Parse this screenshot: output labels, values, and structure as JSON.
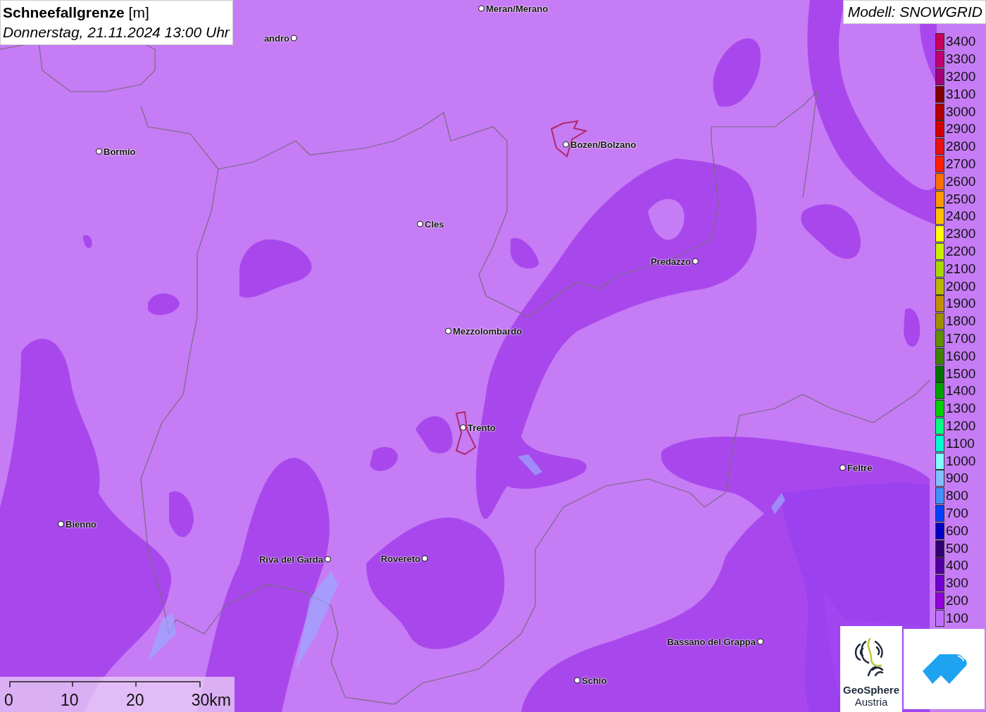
{
  "title": {
    "name": "Schneefallgrenze",
    "unit": "[m]",
    "datetime": "Donnerstag, 21.11.2024 13:00 Uhr"
  },
  "model": "Modell: SNOWGRID",
  "cities": [
    {
      "name": "Meran/Merano"
    },
    {
      "name": "andro"
    },
    {
      "name": "Bormio"
    },
    {
      "name": "Bozen/Bolzano"
    },
    {
      "name": "Cles"
    },
    {
      "name": "Predazzo"
    },
    {
      "name": "Mezzolombardo"
    },
    {
      "name": "Trento"
    },
    {
      "name": "Feltre"
    },
    {
      "name": "Bienno"
    },
    {
      "name": "Riva del Garda"
    },
    {
      "name": "Rovereto"
    },
    {
      "name": "Bassano del Grappa"
    },
    {
      "name": "Schio"
    }
  ],
  "legend": [
    {
      "label": "3400",
      "color": "#c8005a"
    },
    {
      "label": "3300",
      "color": "#c0006e"
    },
    {
      "label": "3200",
      "color": "#a00078"
    },
    {
      "label": "3100",
      "color": "#800000"
    },
    {
      "label": "3000",
      "color": "#b00000"
    },
    {
      "label": "2900",
      "color": "#d00000"
    },
    {
      "label": "2800",
      "color": "#e81010"
    },
    {
      "label": "2700",
      "color": "#ff2000"
    },
    {
      "label": "2600",
      "color": "#ff7000"
    },
    {
      "label": "2500",
      "color": "#ff9a00"
    },
    {
      "label": "2400",
      "color": "#ffc000"
    },
    {
      "label": "2300",
      "color": "#ffff00"
    },
    {
      "label": "2200",
      "color": "#c8f000"
    },
    {
      "label": "2100",
      "color": "#a8d800"
    },
    {
      "label": "2000",
      "color": "#b8b800"
    },
    {
      "label": "1900",
      "color": "#c09000"
    },
    {
      "label": "1800",
      "color": "#a09000"
    },
    {
      "label": "1700",
      "color": "#609000"
    },
    {
      "label": "1600",
      "color": "#408000"
    },
    {
      "label": "1500",
      "color": "#007000"
    },
    {
      "label": "1400",
      "color": "#00a000"
    },
    {
      "label": "1300",
      "color": "#00d000"
    },
    {
      "label": "1200",
      "color": "#00ff80"
    },
    {
      "label": "1100",
      "color": "#00ffd0"
    },
    {
      "label": "1000",
      "color": "#80ffff"
    },
    {
      "label": "900",
      "color": "#80c0ff"
    },
    {
      "label": "800",
      "color": "#4090ff"
    },
    {
      "label": "700",
      "color": "#0040ff"
    },
    {
      "label": "600",
      "color": "#0000c0"
    },
    {
      "label": "500",
      "color": "#300070"
    },
    {
      "label": "400",
      "color": "#5000a0"
    },
    {
      "label": "300",
      "color": "#7000d0"
    },
    {
      "label": "200",
      "color": "#9000d8"
    },
    {
      "label": "100",
      "color": "#c070ff"
    }
  ],
  "scale": [
    "0",
    "10",
    "20",
    "30km"
  ],
  "logo": {
    "name": "GeoSphere",
    "subtitle": "Austria"
  }
}
